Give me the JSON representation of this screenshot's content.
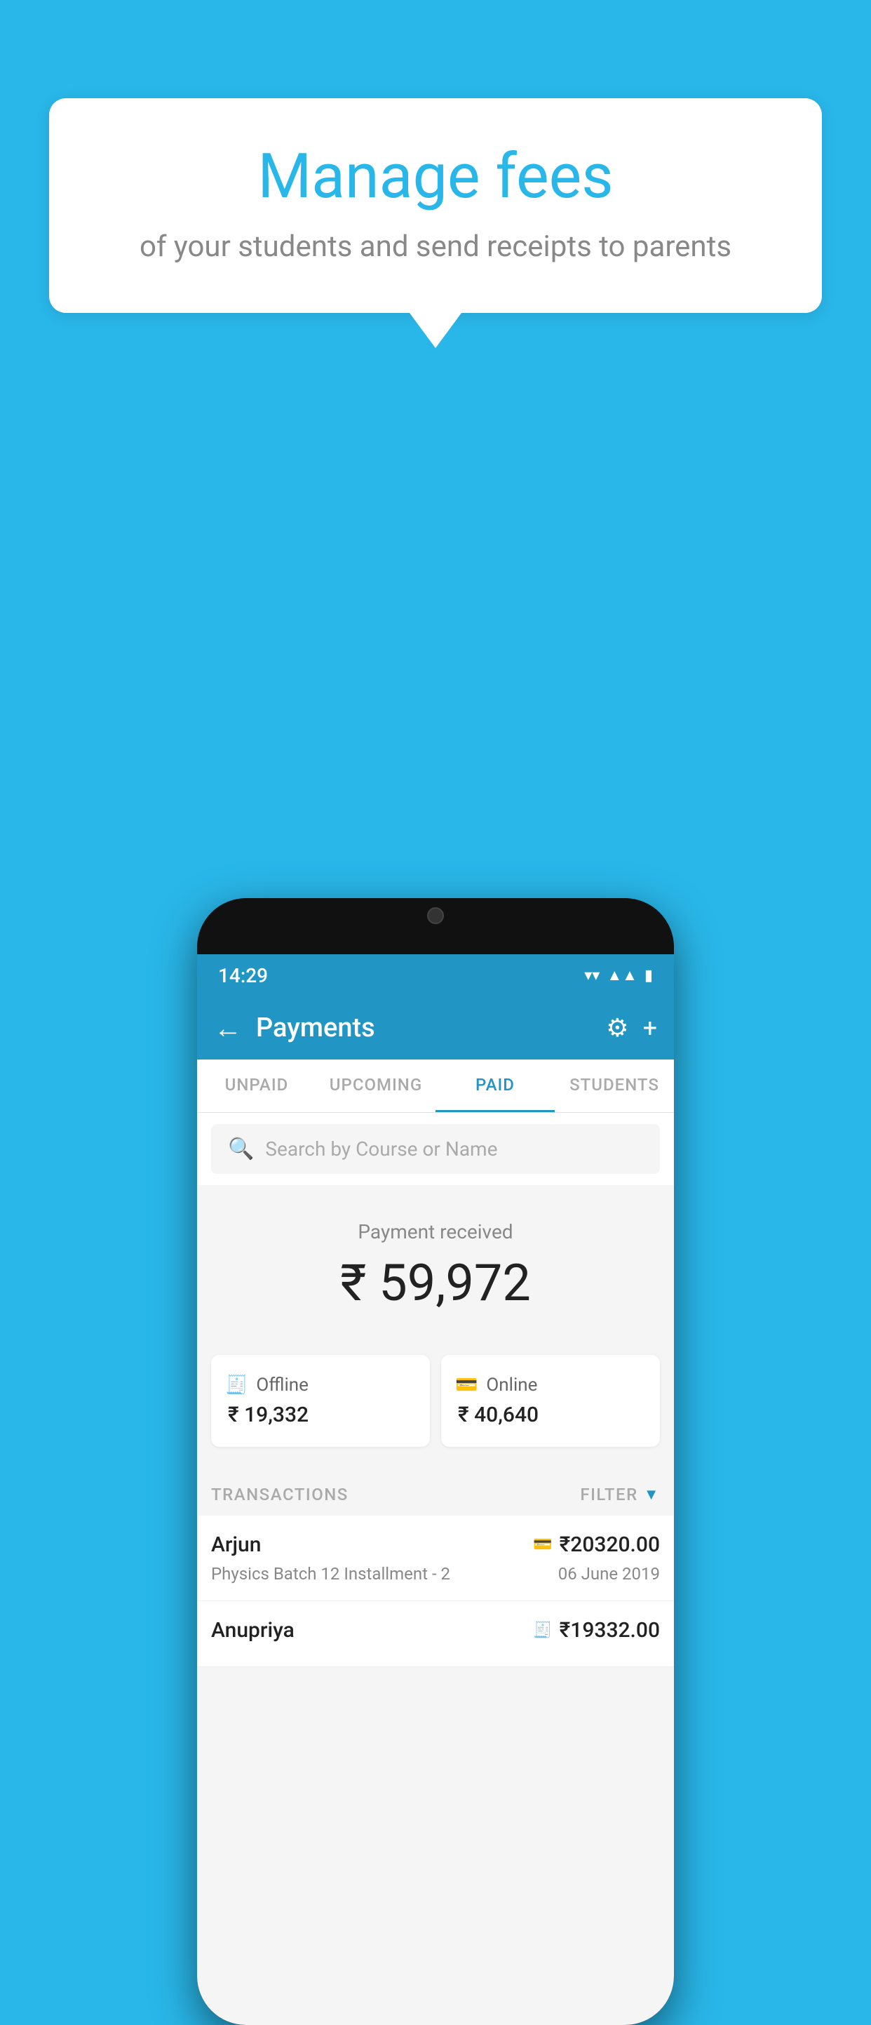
{
  "background_color": "#29b6e8",
  "speech_bubble": {
    "title": "Manage fees",
    "subtitle": "of your students and send receipts to parents"
  },
  "phone": {
    "status_bar": {
      "time": "14:29",
      "icons": [
        "wifi",
        "signal",
        "battery"
      ]
    },
    "header": {
      "title": "Payments",
      "back_label": "←",
      "settings_label": "⚙",
      "add_label": "+"
    },
    "tabs": [
      {
        "label": "UNPAID",
        "active": false
      },
      {
        "label": "UPCOMING",
        "active": false
      },
      {
        "label": "PAID",
        "active": true
      },
      {
        "label": "STUDENTS",
        "active": false
      }
    ],
    "search": {
      "placeholder": "Search by Course or Name"
    },
    "payment_summary": {
      "label": "Payment received",
      "amount": "₹ 59,972"
    },
    "payment_cards": [
      {
        "icon": "offline",
        "label": "Offline",
        "amount": "₹ 19,332"
      },
      {
        "icon": "online",
        "label": "Online",
        "amount": "₹ 40,640"
      }
    ],
    "transactions_header": {
      "label": "TRANSACTIONS",
      "filter_label": "FILTER"
    },
    "transactions": [
      {
        "name": "Arjun",
        "course": "Physics Batch 12 Installment - 2",
        "amount": "₹20320.00",
        "date": "06 June 2019",
        "type": "online"
      },
      {
        "name": "Anupriya",
        "course": "",
        "amount": "₹19332.00",
        "date": "",
        "type": "offline"
      }
    ]
  }
}
